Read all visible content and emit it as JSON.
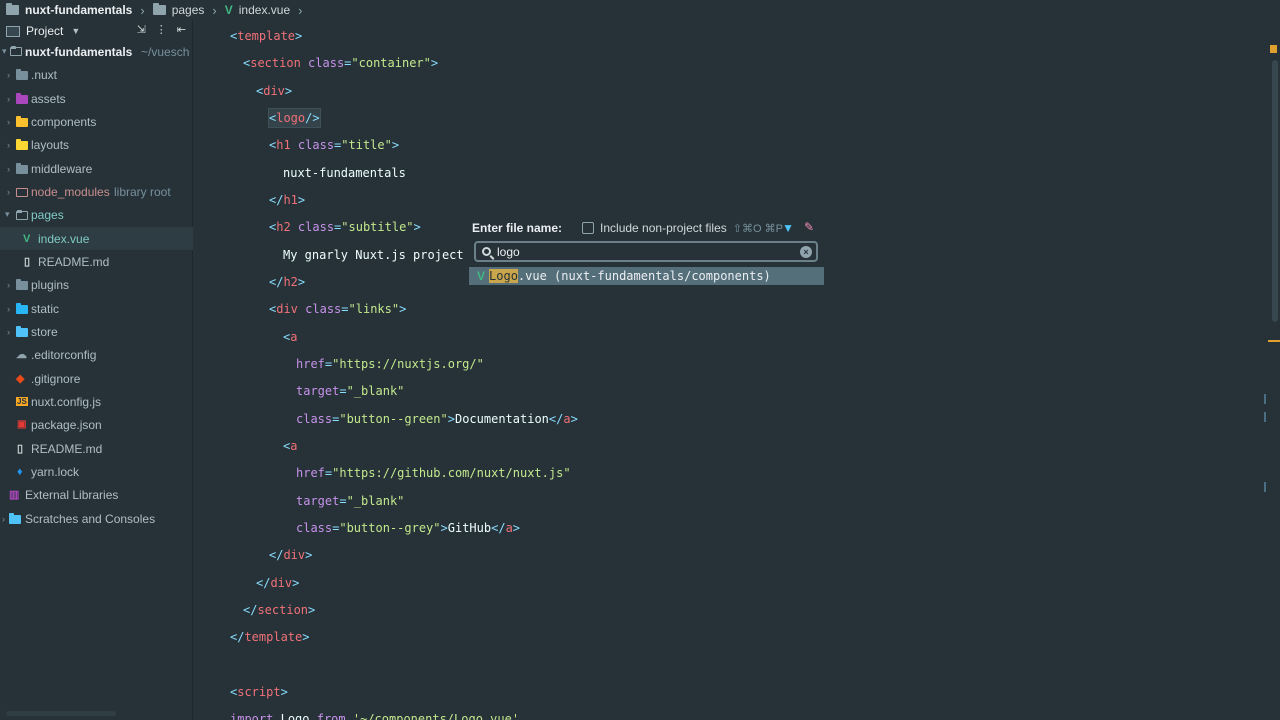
{
  "breadcrumb": {
    "project": "nuxt-fundamentals",
    "folder": "pages",
    "file": "index.vue"
  },
  "sidebar": {
    "header": "Project",
    "root": {
      "name": "nuxt-fundamentals",
      "path": "~/vuesch"
    },
    "items": [
      {
        "label": ".nuxt"
      },
      {
        "label": "assets"
      },
      {
        "label": "components"
      },
      {
        "label": "layouts"
      },
      {
        "label": "middleware"
      },
      {
        "label": "node_modules",
        "suffix": "library root"
      },
      {
        "label": "pages"
      },
      {
        "label": "index.vue"
      },
      {
        "label": "README.md"
      },
      {
        "label": "plugins"
      },
      {
        "label": "static"
      },
      {
        "label": "store"
      },
      {
        "label": ".editorconfig"
      },
      {
        "label": ".gitignore"
      },
      {
        "label": "nuxt.config.js"
      },
      {
        "label": "package.json"
      },
      {
        "label": "README.md"
      },
      {
        "label": "yarn.lock"
      },
      {
        "label": "External Libraries"
      },
      {
        "label": "Scratches and Consoles"
      }
    ]
  },
  "code": {
    "l1": "template",
    "l2_tag": "section",
    "l2_attr": "class",
    "l2_val": "\"container\"",
    "l3": "div",
    "l4": "logo",
    "l5_tag": "h1",
    "l5_attr": "class",
    "l5_val": "\"title\"",
    "l6": "nuxt-fundamentals",
    "l7": "h1",
    "l8_tag": "h2",
    "l8_attr": "class",
    "l8_val": "\"subtitle\"",
    "l9": "My gnarly Nuxt.js project",
    "l10": "h2",
    "l11_tag": "div",
    "l11_attr": "class",
    "l11_val": "\"links\"",
    "l12": "a",
    "l13_attr": "href",
    "l13_val": "\"https://nuxtjs.org/\"",
    "l14_attr": "target",
    "l14_val": "\"_blank\"",
    "l15_attr": "class",
    "l15_val": "\"button--green\"",
    "l15_text": "Documentation",
    "l16": "a",
    "l17_attr": "href",
    "l17_val": "\"https://github.com/nuxt/nuxt.js\"",
    "l18_attr": "target",
    "l18_val": "\"_blank\"",
    "l19_attr": "class",
    "l19_val": "\"button--grey\"",
    "l19_text": "GitHub",
    "l20": "div",
    "l21": "div",
    "l22": "section",
    "l23": "template",
    "l24": "script",
    "l25_kw": "import",
    "l25_name": "Logo",
    "l25_from": "from",
    "l25_val": "'~/components/Logo.vue'"
  },
  "popup": {
    "title": "Enter file name:",
    "checkbox_label": "Include non-project files",
    "shortcut": "⇧⌘O ⌘P",
    "search_value": "logo",
    "result_match": "Logo",
    "result_rest": ".vue (nuxt-fundamentals/components)"
  },
  "colors": {
    "tag": "#f07178",
    "attr": "#c792ea",
    "string": "#c3e88d",
    "vue": "#41b883",
    "highlight": "#c9a54b"
  }
}
